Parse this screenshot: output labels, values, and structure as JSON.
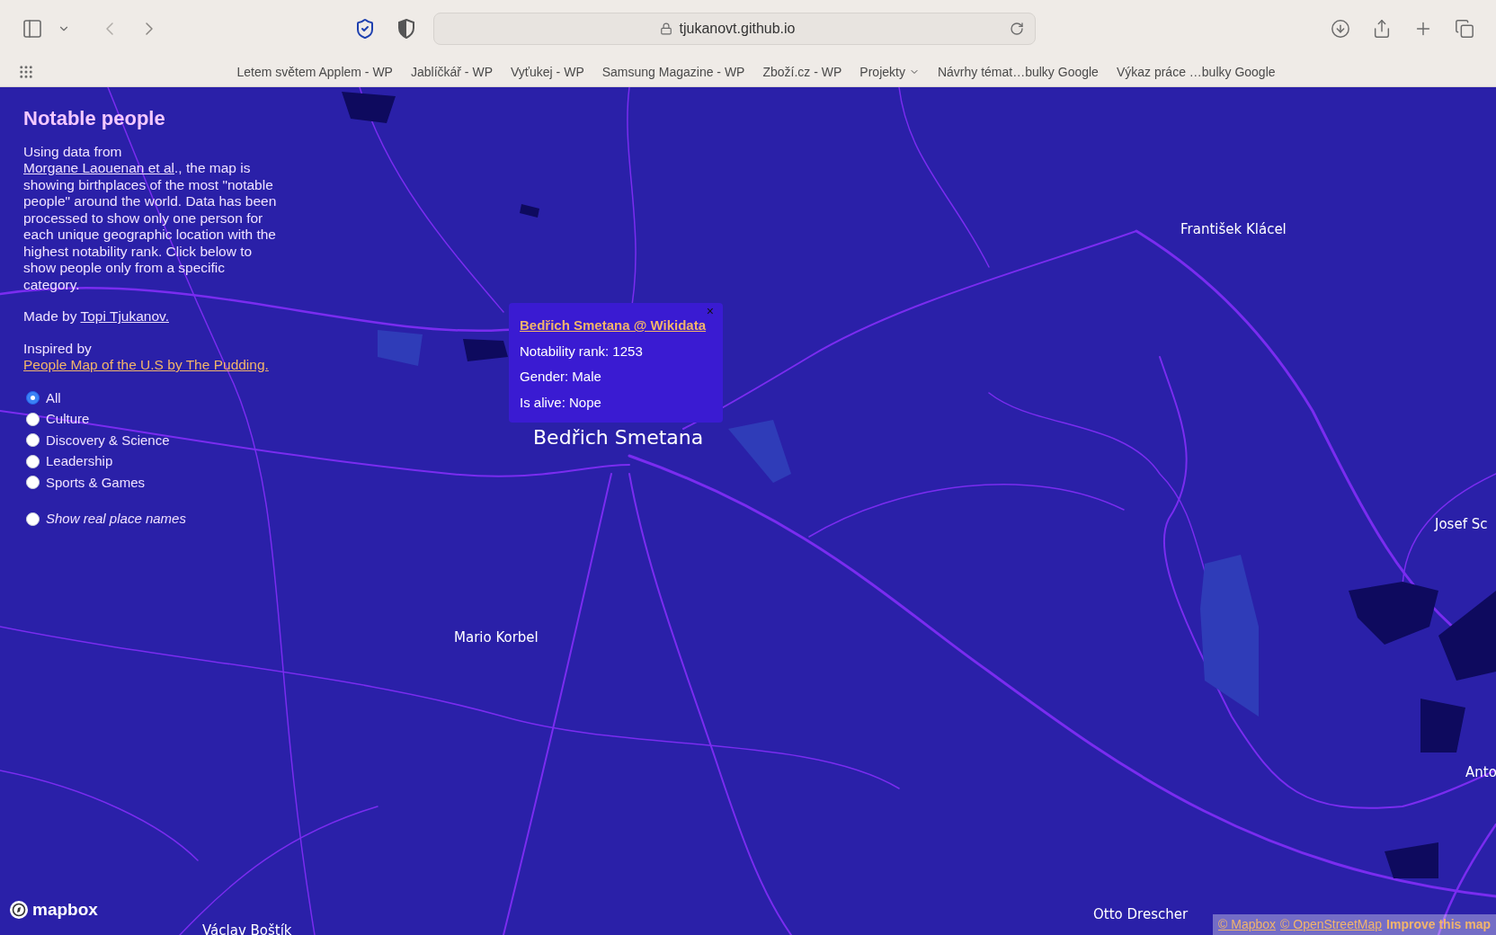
{
  "browser": {
    "url": "tjukanovt.github.io",
    "bookmarks": [
      {
        "label": "Letem světem Applem - WP",
        "kind": "link"
      },
      {
        "label": "Jablíčkář - WP",
        "kind": "link"
      },
      {
        "label": "Vyťukej - WP",
        "kind": "link"
      },
      {
        "label": "Samsung Magazine - WP",
        "kind": "link"
      },
      {
        "label": "Zboží.cz - WP",
        "kind": "link"
      },
      {
        "label": "Projekty",
        "kind": "folder"
      },
      {
        "label": "Návrhy témat…bulky Google",
        "kind": "link"
      },
      {
        "label": "Výkaz práce …bulky Google",
        "kind": "link"
      }
    ]
  },
  "panel": {
    "title": "Notable people",
    "intro": {
      "before": "Using data from ",
      "link": "Morgane Laouenan et al",
      "after": "., the map is showing birthplaces of the most \"notable people\" around the world. Data has been processed to show only one person for each unique geographic location with the highest notability rank. Click below to show people only from a specific category."
    },
    "made_by": {
      "before": "Made by ",
      "link": "Topi Tjukanov."
    },
    "inspired_by": {
      "before": "Inspired by ",
      "link": "People Map of the U.S by The Pudding."
    },
    "categories": [
      {
        "label": "All",
        "selected": true
      },
      {
        "label": "Culture",
        "selected": false
      },
      {
        "label": "Discovery & Science",
        "selected": false
      },
      {
        "label": "Leadership",
        "selected": false
      },
      {
        "label": "Sports & Games",
        "selected": false
      }
    ],
    "place_names": {
      "label": "Show real place names",
      "checked": false
    }
  },
  "popup": {
    "title": "Bedřich Smetana @ Wikidata",
    "close": "×",
    "lines": [
      "Notability rank: 1253",
      "Gender: Male",
      "Is alive: Nope"
    ]
  },
  "map_labels": [
    {
      "label": "František Klácel",
      "kind": "small"
    },
    {
      "label": "Bedřich Smetana",
      "kind": "large"
    },
    {
      "label": "Josef Sc",
      "kind": "small"
    },
    {
      "label": "Mario Korbel",
      "kind": "small"
    },
    {
      "label": "Anto",
      "kind": "small"
    },
    {
      "label": "Otto Drescher",
      "kind": "small"
    },
    {
      "label": "Václav Boštík",
      "kind": "small"
    }
  ],
  "logo": "mapbox",
  "attribution": [
    "© Mapbox",
    "© OpenStreetMap",
    "Improve this map"
  ]
}
